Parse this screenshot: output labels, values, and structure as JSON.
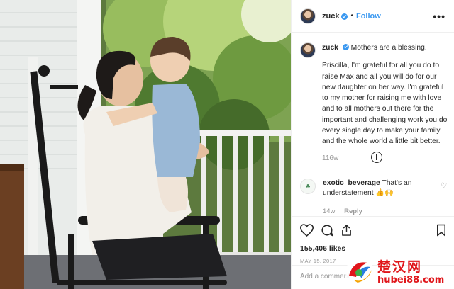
{
  "post": {
    "username": "zuck",
    "follow_label": "Follow",
    "separator": "•",
    "more_label": "•••",
    "caption_first": "Mothers are a blessing.",
    "caption_body": "Priscilla, I'm grateful for all you do to raise Max and all you will do for our new daughter on her way. I'm grateful to my mother for raising me with love and to all mothers out there for the important and challenging work you do every single day to make your family and the whole world a little bit better.",
    "caption_time": "116w",
    "likes": "155,406 likes",
    "date": "MAY 15, 2017",
    "add_comment_placeholder": "Add a comment..."
  },
  "comment": {
    "username": "exotic_beverage",
    "text": "That's an understatement 👍🙌",
    "time": "14w",
    "reply_label": "Reply"
  },
  "watermark": {
    "brand": "楚汉网",
    "url": "hubei88.com"
  },
  "colors": {
    "accent": "#3897f0",
    "watermark": "#e0161b",
    "muted": "#999999"
  }
}
